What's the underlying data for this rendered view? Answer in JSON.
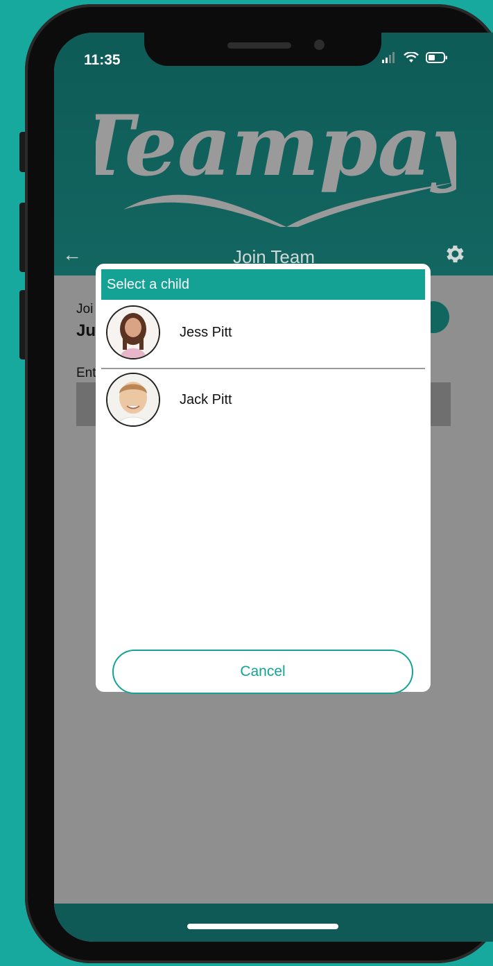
{
  "status_bar": {
    "time": "11:35"
  },
  "app": {
    "logo_text": "Teampay"
  },
  "nav": {
    "title": "Join Team"
  },
  "background": {
    "label_1": "Joi",
    "label_2": "Ju",
    "label_3": "Ent"
  },
  "modal": {
    "header": "Select a child",
    "children": [
      {
        "name": "Jess Pitt"
      },
      {
        "name": "Jack Pitt"
      }
    ],
    "cancel_label": "Cancel"
  },
  "colors": {
    "accent": "#13a294",
    "header_bg": "#0f5a56",
    "frame_bg": "#17a89e"
  }
}
